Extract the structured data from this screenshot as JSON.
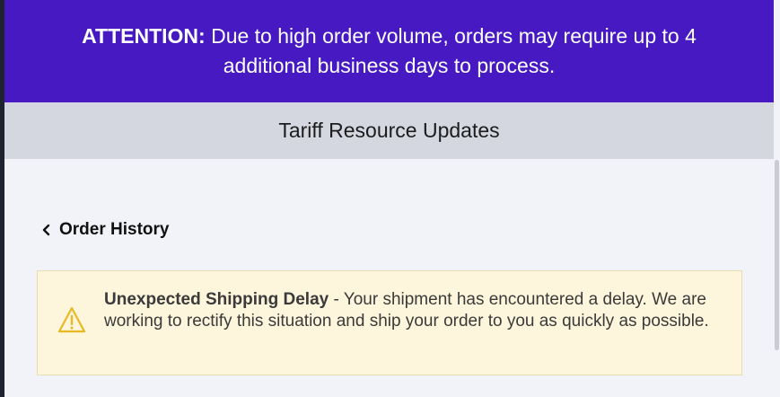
{
  "banner": {
    "attention_label": "ATTENTION:",
    "attention_text": " Due to high order volume, orders may require up to 4 additional business days to process."
  },
  "tariff_bar": {
    "label": "Tariff Resource Updates"
  },
  "nav": {
    "back_label": "Order History",
    "back_icon": "chevron-left-icon"
  },
  "alert": {
    "icon": "warning-triangle-icon",
    "title": "Unexpected Shipping Delay",
    "message": " - Your shipment has encountered a delay. We are working to rectify this situation and ship your order to you as quickly as possible."
  },
  "colors": {
    "banner_bg": "#4619c2",
    "tariff_bg": "#d4d7df",
    "page_bg": "#f2f3f8",
    "alert_bg": "#fdf6dc",
    "warning_icon": "#e8b923"
  }
}
